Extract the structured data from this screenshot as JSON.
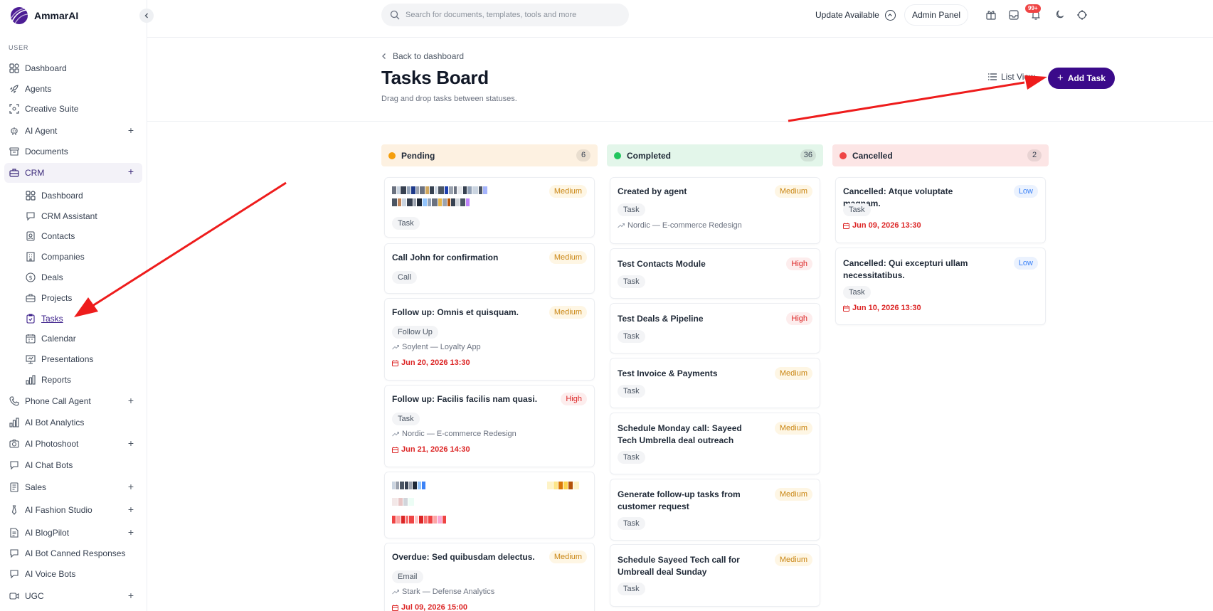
{
  "app": {
    "name": "AmmarAI"
  },
  "sidebar": {
    "section_label": "USER",
    "items": [
      {
        "label": "Dashboard",
        "icon": "grid-icon"
      },
      {
        "label": "Agents",
        "icon": "rocket-icon"
      },
      {
        "label": "Creative Suite",
        "icon": "frame-icon"
      },
      {
        "label": "AI Agent",
        "icon": "robot-icon",
        "expand": "+"
      },
      {
        "label": "Documents",
        "icon": "archive-icon"
      },
      {
        "label": "CRM",
        "icon": "briefcase-icon",
        "expand": "+"
      },
      {
        "label": "Phone Call Agent",
        "icon": "phone-icon",
        "expand": "+"
      },
      {
        "label": "AI Bot Analytics",
        "icon": "bar-chart-icon"
      },
      {
        "label": "AI Photoshoot",
        "icon": "camera-icon",
        "expand": "+"
      },
      {
        "label": "AI Chat Bots",
        "icon": "chat-icon"
      },
      {
        "label": "Sales",
        "icon": "clipboard-icon",
        "expand": "+"
      },
      {
        "label": "AI Fashion Studio",
        "icon": "tie-icon",
        "expand": "+"
      },
      {
        "label": "AI BlogPilot",
        "icon": "document-icon",
        "expand": "+"
      },
      {
        "label": "AI Bot Canned Responses",
        "icon": "chat-icon"
      },
      {
        "label": "AI Voice Bots",
        "icon": "chat-icon"
      },
      {
        "label": "UGC",
        "icon": "video-icon",
        "expand": "+"
      }
    ],
    "crm_items": [
      {
        "label": "Dashboard",
        "icon": "grid-icon"
      },
      {
        "label": "CRM Assistant",
        "icon": "chat-icon"
      },
      {
        "label": "Contacts",
        "icon": "contacts-icon"
      },
      {
        "label": "Companies",
        "icon": "building-icon"
      },
      {
        "label": "Deals",
        "icon": "dollar-icon"
      },
      {
        "label": "Projects",
        "icon": "briefcase-icon"
      },
      {
        "label": "Tasks",
        "icon": "task-icon"
      },
      {
        "label": "Calendar",
        "icon": "calendar-icon"
      },
      {
        "label": "Presentations",
        "icon": "presentation-icon"
      },
      {
        "label": "Reports",
        "icon": "bar-chart-icon"
      }
    ]
  },
  "topbar": {
    "search_placeholder": "Search for documents, templates, tools and more",
    "update_label": "Update Available",
    "admin_label": "Admin Panel",
    "notification_badge": "99+"
  },
  "page": {
    "back_label": "Back to dashboard",
    "title": "Tasks Board",
    "subtitle": "Drag and drop tasks between statuses.",
    "list_view_label": "List View",
    "add_task_label": "Add Task"
  },
  "colors": {
    "accent": "#3b0a8a",
    "pending": "#f59e0b",
    "completed": "#22c55e",
    "cancelled": "#ef4444"
  },
  "columns": [
    {
      "title": "Pending",
      "count": "6",
      "cards": [
        {
          "title": "",
          "blurred": true,
          "priority": "Medium",
          "tag": "Task"
        },
        {
          "title": "Call John for confirmation",
          "priority": "Medium",
          "tag": "Call"
        },
        {
          "title": "Follow up: Omnis et quisquam.",
          "priority": "Medium",
          "tag": "Follow Up",
          "project": "Soylent — Loyalty App",
          "due": "Jun 20, 2026 13:30"
        },
        {
          "title": "Follow up: Facilis facilis nam quasi.",
          "priority": "High",
          "tag": "Task",
          "project": "Nordic — E-commerce Redesign",
          "due": "Jun 21, 2026 14:30"
        },
        {
          "title": "",
          "blurred": true,
          "priority": "",
          "tag": ""
        },
        {
          "title": "Overdue: Sed quibusdam delectus.",
          "priority": "Medium",
          "tag": "Email",
          "project": "Stark — Defense Analytics",
          "due": "Jul 09, 2026 15:00"
        }
      ]
    },
    {
      "title": "Completed",
      "count": "36",
      "cards": [
        {
          "title": "Created by agent",
          "priority": "Medium",
          "tag": "Task",
          "project": "Nordic — E-commerce Redesign"
        },
        {
          "title": "Test Contacts Module",
          "priority": "High",
          "tag": "Task"
        },
        {
          "title": "Test Deals & Pipeline",
          "priority": "High",
          "tag": "Task"
        },
        {
          "title": "Test Invoice & Payments",
          "priority": "Medium",
          "tag": "Task"
        },
        {
          "title": "Schedule Monday call: Sayeed Tech Umbrella deal outreach",
          "priority": "Medium",
          "tag": "Task"
        },
        {
          "title": "Generate follow-up tasks from customer request",
          "priority": "Medium",
          "tag": "Task"
        },
        {
          "title": "Schedule Sayeed Tech call for Umbreall deal Sunday",
          "priority": "Medium",
          "tag": "Task"
        }
      ]
    },
    {
      "title": "Cancelled",
      "count": "2",
      "cards": [
        {
          "title": "Cancelled: Atque voluptate magnam.",
          "priority": "Low",
          "tag": "Task",
          "due": "Jun 09, 2026 13:30"
        },
        {
          "title": "Cancelled: Qui excepturi ullam necessitatibus.",
          "priority": "Low",
          "tag": "Task",
          "due": "Jun 10, 2026 13:30"
        }
      ]
    }
  ]
}
